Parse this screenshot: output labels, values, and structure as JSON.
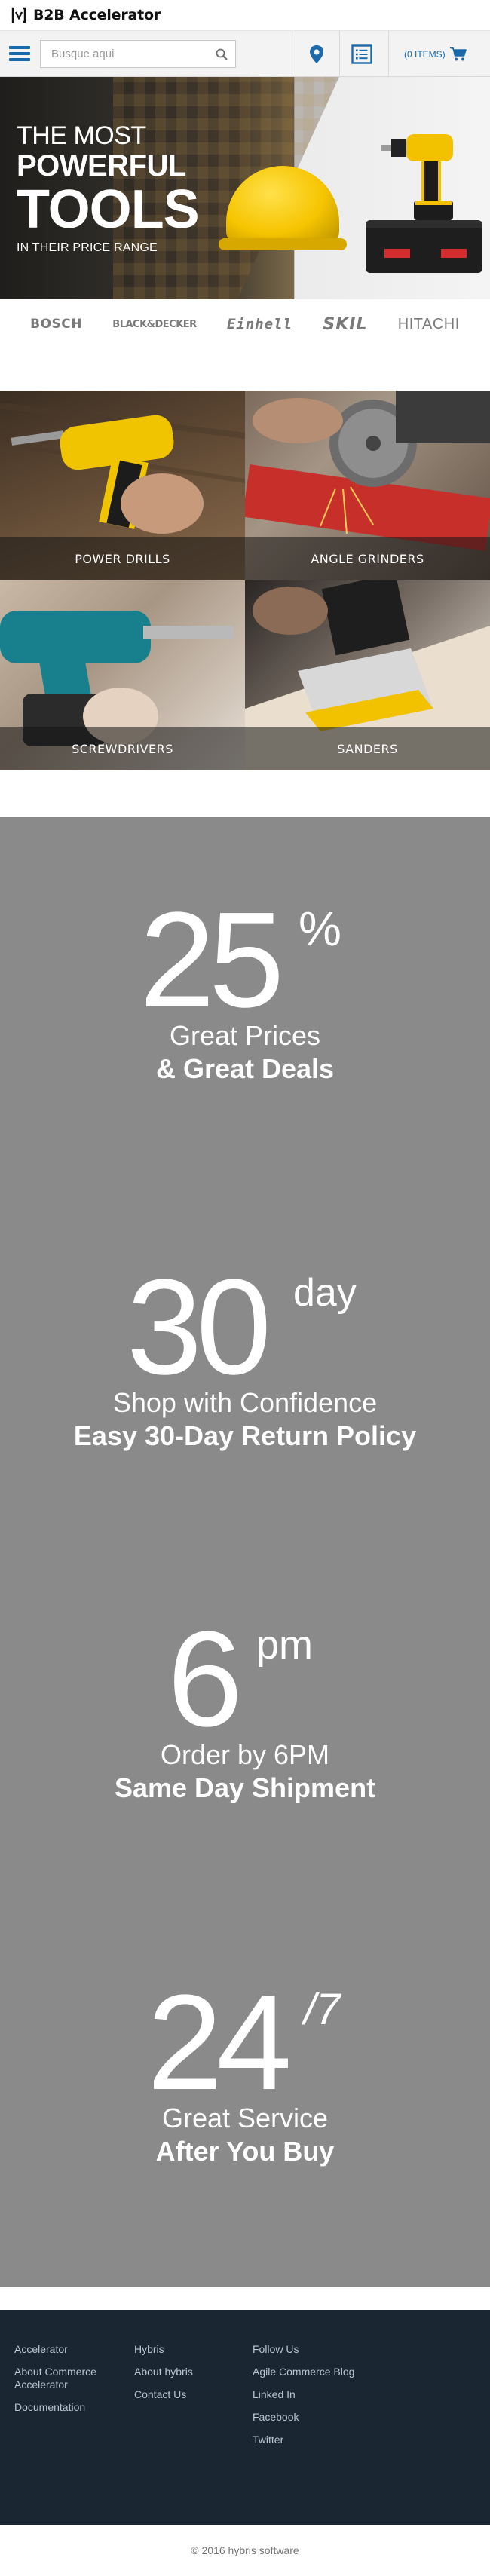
{
  "header": {
    "app_title": "B2B Accelerator"
  },
  "nav": {
    "search_placeholder": "Busque aqui",
    "cart_label": "(0 ITEMS)"
  },
  "hero": {
    "line1": "THE MOST",
    "line2": "POWERFUL",
    "line3": "TOOLS",
    "line4": "IN THEIR PRICE RANGE"
  },
  "brands": [
    "BOSCH",
    "BLACK&DECKER",
    "Einhell",
    "SKIL",
    "HITACHI"
  ],
  "categories": [
    "POWER DRILLS",
    "ANGLE GRINDERS",
    "SCREWDRIVERS",
    "SANDERS"
  ],
  "promos": [
    {
      "big": "25",
      "sup": "%",
      "line1": "Great Prices",
      "line2": "& Great Deals"
    },
    {
      "big": "30",
      "sup": "day",
      "line1": "Shop with Confidence",
      "line2": "Easy 30-Day Return Policy"
    },
    {
      "big": "6",
      "sup": "pm",
      "line1": "Order by 6PM",
      "line2": "Same Day Shipment"
    },
    {
      "big": "24",
      "sup": "/7",
      "line1": "Great Service",
      "line2": "After You Buy"
    }
  ],
  "footer": {
    "col1": [
      "Accelerator",
      "About Commerce Accelerator",
      "Documentation"
    ],
    "col2": [
      "Hybris",
      "About hybris",
      "Contact Us"
    ],
    "col3": [
      "Follow Us",
      "Agile Commerce Blog",
      "Linked In",
      "Facebook",
      "Twitter"
    ]
  },
  "copyright": "© 2016 hybris software",
  "colors": {
    "accent": "#1a6aab",
    "promo_bg": "#8a8a8a",
    "footer_bg": "#1a2733"
  }
}
